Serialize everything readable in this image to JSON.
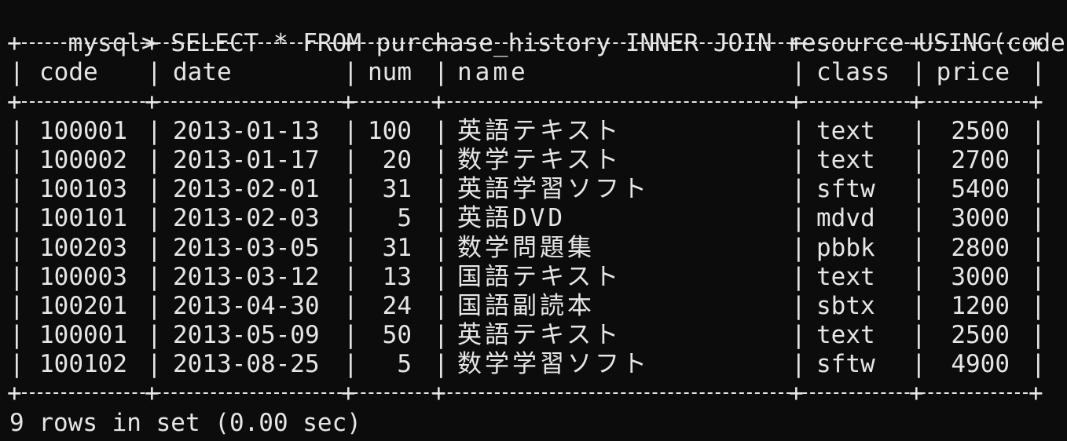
{
  "prompt": "mysql>",
  "command": "SELECT * FROM purchase_history INNER JOIN resource USING(code);",
  "columns": [
    "code",
    "date",
    "num",
    "name",
    "class",
    "price"
  ],
  "rows": [
    [
      "100001",
      "2013-01-13",
      "100",
      "英語テキスト",
      "text",
      "2500"
    ],
    [
      "100002",
      "2013-01-17",
      "20",
      "数学テキスト",
      "text",
      "2700"
    ],
    [
      "100103",
      "2013-02-01",
      "31",
      "英語学習ソフト",
      "sftw",
      "5400"
    ],
    [
      "100101",
      "2013-02-03",
      "5",
      "英語DVD",
      "mdvd",
      "3000"
    ],
    [
      "100203",
      "2013-03-05",
      "31",
      "数学問題集",
      "pbbk",
      "2800"
    ],
    [
      "100003",
      "2013-03-12",
      "13",
      "国語テキスト",
      "text",
      "3000"
    ],
    [
      "100201",
      "2013-04-30",
      "24",
      "国語副読本",
      "sbtx",
      "1200"
    ],
    [
      "100001",
      "2013-05-09",
      "50",
      "英語テキスト",
      "text",
      "2500"
    ],
    [
      "100102",
      "2013-08-25",
      "5",
      "数学学習ソフト",
      "sftw",
      "4900"
    ]
  ],
  "footer": "9 rows in set (0.00 sec)",
  "colors": {
    "background": "#0c0c0c",
    "foreground": "#e6e6e6"
  }
}
